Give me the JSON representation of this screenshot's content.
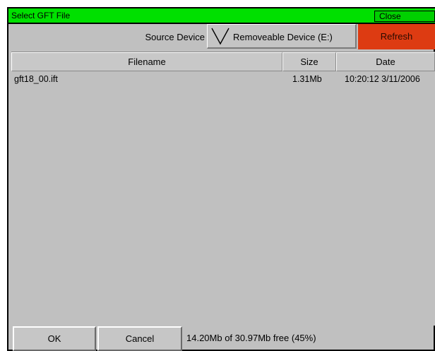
{
  "window": {
    "title": "Select GFT File",
    "close_label": "Close"
  },
  "source": {
    "label": "Source Device",
    "device": "Removeable Device (E:)",
    "refresh_label": "Refresh"
  },
  "list": {
    "columns": [
      "Filename",
      "Size",
      "Date"
    ],
    "rows": [
      {
        "filename": "gft18_00.ift",
        "size": "1.31Mb",
        "date": "10:20:12 3/11/2006"
      }
    ]
  },
  "footer": {
    "ok_label": "OK",
    "cancel_label": "Cancel",
    "free_space": "14.20Mb of 30.97Mb free (45%)"
  },
  "colors": {
    "titlebar": "#00e000",
    "refresh": "#dd3b12",
    "background": "#c0c0c0"
  }
}
